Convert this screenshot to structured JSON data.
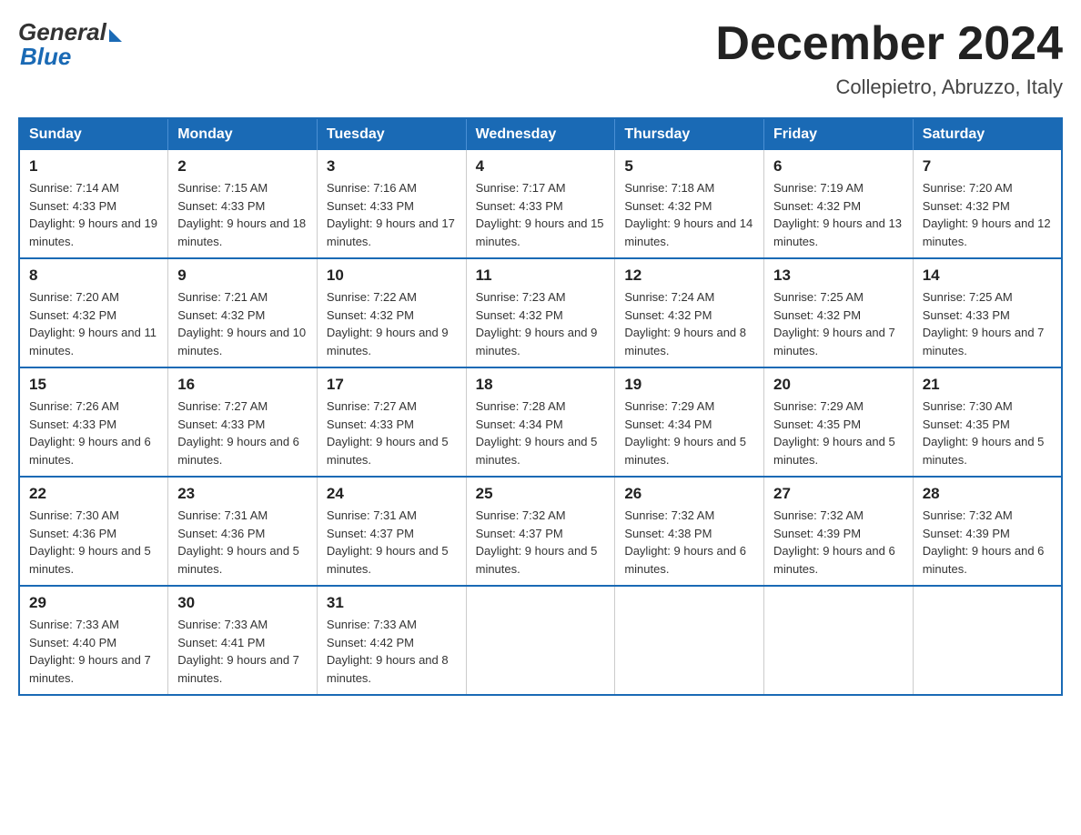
{
  "logo": {
    "general": "General",
    "blue": "Blue"
  },
  "title": "December 2024",
  "location": "Collepietro, Abruzzo, Italy",
  "days_of_week": [
    "Sunday",
    "Monday",
    "Tuesday",
    "Wednesday",
    "Thursday",
    "Friday",
    "Saturday"
  ],
  "weeks": [
    [
      {
        "day": "1",
        "sunrise": "7:14 AM",
        "sunset": "4:33 PM",
        "daylight": "9 hours and 19 minutes."
      },
      {
        "day": "2",
        "sunrise": "7:15 AM",
        "sunset": "4:33 PM",
        "daylight": "9 hours and 18 minutes."
      },
      {
        "day": "3",
        "sunrise": "7:16 AM",
        "sunset": "4:33 PM",
        "daylight": "9 hours and 17 minutes."
      },
      {
        "day": "4",
        "sunrise": "7:17 AM",
        "sunset": "4:33 PM",
        "daylight": "9 hours and 15 minutes."
      },
      {
        "day": "5",
        "sunrise": "7:18 AM",
        "sunset": "4:32 PM",
        "daylight": "9 hours and 14 minutes."
      },
      {
        "day": "6",
        "sunrise": "7:19 AM",
        "sunset": "4:32 PM",
        "daylight": "9 hours and 13 minutes."
      },
      {
        "day": "7",
        "sunrise": "7:20 AM",
        "sunset": "4:32 PM",
        "daylight": "9 hours and 12 minutes."
      }
    ],
    [
      {
        "day": "8",
        "sunrise": "7:20 AM",
        "sunset": "4:32 PM",
        "daylight": "9 hours and 11 minutes."
      },
      {
        "day": "9",
        "sunrise": "7:21 AM",
        "sunset": "4:32 PM",
        "daylight": "9 hours and 10 minutes."
      },
      {
        "day": "10",
        "sunrise": "7:22 AM",
        "sunset": "4:32 PM",
        "daylight": "9 hours and 9 minutes."
      },
      {
        "day": "11",
        "sunrise": "7:23 AM",
        "sunset": "4:32 PM",
        "daylight": "9 hours and 9 minutes."
      },
      {
        "day": "12",
        "sunrise": "7:24 AM",
        "sunset": "4:32 PM",
        "daylight": "9 hours and 8 minutes."
      },
      {
        "day": "13",
        "sunrise": "7:25 AM",
        "sunset": "4:32 PM",
        "daylight": "9 hours and 7 minutes."
      },
      {
        "day": "14",
        "sunrise": "7:25 AM",
        "sunset": "4:33 PM",
        "daylight": "9 hours and 7 minutes."
      }
    ],
    [
      {
        "day": "15",
        "sunrise": "7:26 AM",
        "sunset": "4:33 PM",
        "daylight": "9 hours and 6 minutes."
      },
      {
        "day": "16",
        "sunrise": "7:27 AM",
        "sunset": "4:33 PM",
        "daylight": "9 hours and 6 minutes."
      },
      {
        "day": "17",
        "sunrise": "7:27 AM",
        "sunset": "4:33 PM",
        "daylight": "9 hours and 5 minutes."
      },
      {
        "day": "18",
        "sunrise": "7:28 AM",
        "sunset": "4:34 PM",
        "daylight": "9 hours and 5 minutes."
      },
      {
        "day": "19",
        "sunrise": "7:29 AM",
        "sunset": "4:34 PM",
        "daylight": "9 hours and 5 minutes."
      },
      {
        "day": "20",
        "sunrise": "7:29 AM",
        "sunset": "4:35 PM",
        "daylight": "9 hours and 5 minutes."
      },
      {
        "day": "21",
        "sunrise": "7:30 AM",
        "sunset": "4:35 PM",
        "daylight": "9 hours and 5 minutes."
      }
    ],
    [
      {
        "day": "22",
        "sunrise": "7:30 AM",
        "sunset": "4:36 PM",
        "daylight": "9 hours and 5 minutes."
      },
      {
        "day": "23",
        "sunrise": "7:31 AM",
        "sunset": "4:36 PM",
        "daylight": "9 hours and 5 minutes."
      },
      {
        "day": "24",
        "sunrise": "7:31 AM",
        "sunset": "4:37 PM",
        "daylight": "9 hours and 5 minutes."
      },
      {
        "day": "25",
        "sunrise": "7:32 AM",
        "sunset": "4:37 PM",
        "daylight": "9 hours and 5 minutes."
      },
      {
        "day": "26",
        "sunrise": "7:32 AM",
        "sunset": "4:38 PM",
        "daylight": "9 hours and 6 minutes."
      },
      {
        "day": "27",
        "sunrise": "7:32 AM",
        "sunset": "4:39 PM",
        "daylight": "9 hours and 6 minutes."
      },
      {
        "day": "28",
        "sunrise": "7:32 AM",
        "sunset": "4:39 PM",
        "daylight": "9 hours and 6 minutes."
      }
    ],
    [
      {
        "day": "29",
        "sunrise": "7:33 AM",
        "sunset": "4:40 PM",
        "daylight": "9 hours and 7 minutes."
      },
      {
        "day": "30",
        "sunrise": "7:33 AM",
        "sunset": "4:41 PM",
        "daylight": "9 hours and 7 minutes."
      },
      {
        "day": "31",
        "sunrise": "7:33 AM",
        "sunset": "4:42 PM",
        "daylight": "9 hours and 8 minutes."
      },
      null,
      null,
      null,
      null
    ]
  ]
}
